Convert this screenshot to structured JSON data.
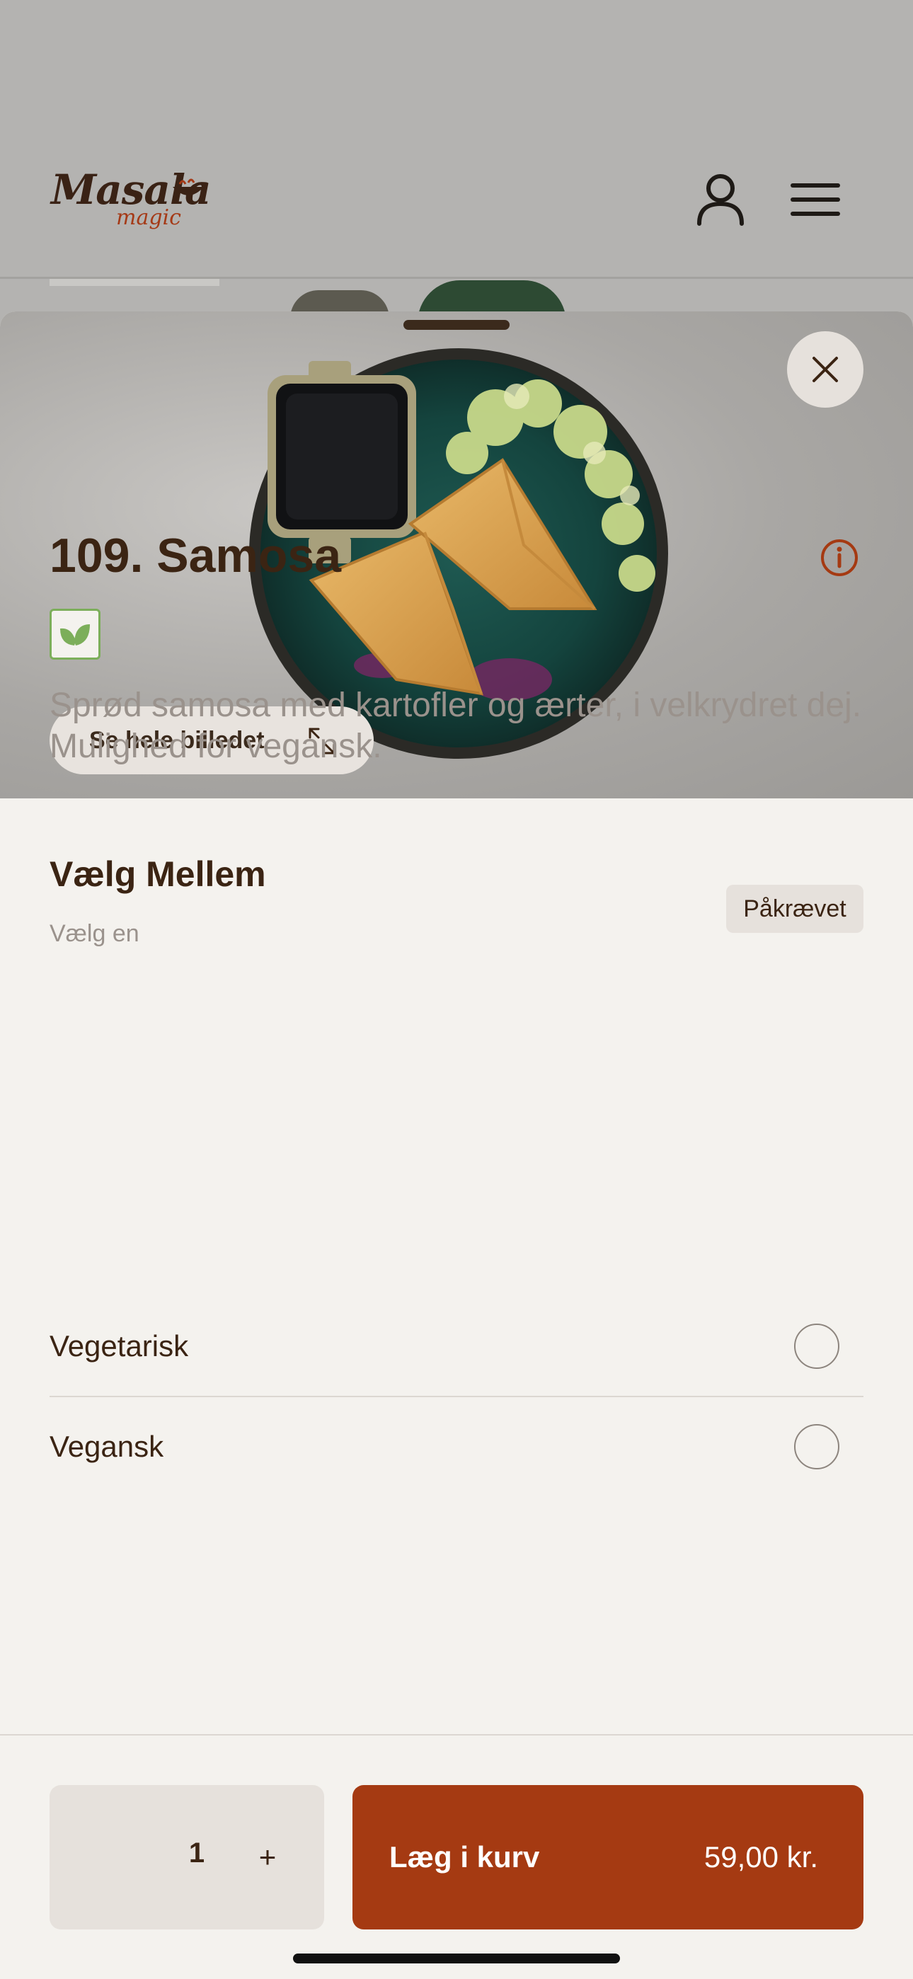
{
  "header": {
    "logo_text": "Masala",
    "logo_sub": "magic",
    "icons": [
      "user-icon",
      "menu-icon"
    ]
  },
  "product": {
    "see_full_image_label": "Se hele billedet",
    "title": "109. Samosa",
    "description": "Sprød samosa med kartofler og ærter, i velkrydret dej. Mulighed for vegansk.",
    "badge_icon": "leaf-icon"
  },
  "option_group": {
    "title": "Vælg Mellem",
    "subtitle": "Vælg en",
    "required_label": "Påkrævet",
    "options": [
      {
        "label": "Vegetarisk",
        "selected": false
      },
      {
        "label": "Vegansk",
        "selected": false
      }
    ]
  },
  "footer": {
    "quantity": "1",
    "plus_label": "+",
    "add_label": "Læg i kurv",
    "price": "59,00 kr."
  },
  "colors": {
    "accent": "#a53a12",
    "text_dark": "#3b2413",
    "text_muted": "#9a928c",
    "veg_green": "#7cae5a"
  }
}
